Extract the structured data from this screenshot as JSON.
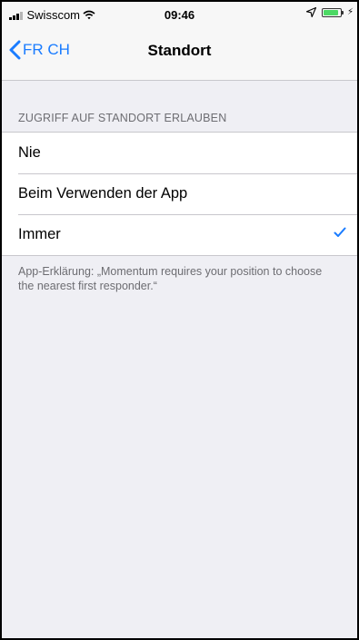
{
  "status_bar": {
    "carrier": "Swisscom",
    "time": "09:46",
    "signal_icon": "cellular-signal-icon",
    "wifi_icon": "wifi-icon",
    "location_icon": "location-arrow-icon",
    "battery_icon": "battery-icon",
    "charging_icon": "charging-bolt-icon"
  },
  "nav": {
    "back_label": "FR CH",
    "title": "Standort"
  },
  "section": {
    "header": "ZUGRIFF AUF STANDORT ERLAUBEN",
    "options": [
      {
        "label": "Nie",
        "selected": false
      },
      {
        "label": "Beim Verwenden der App",
        "selected": false
      },
      {
        "label": "Immer",
        "selected": true
      }
    ],
    "footer": "App-Erklärung: „Momentum requires your position to choose the nearest first responder.“"
  },
  "colors": {
    "accent": "#1a7cff",
    "background": "#efeff4",
    "separator": "#c8c7cc",
    "secondary_text": "#6d6d72"
  }
}
